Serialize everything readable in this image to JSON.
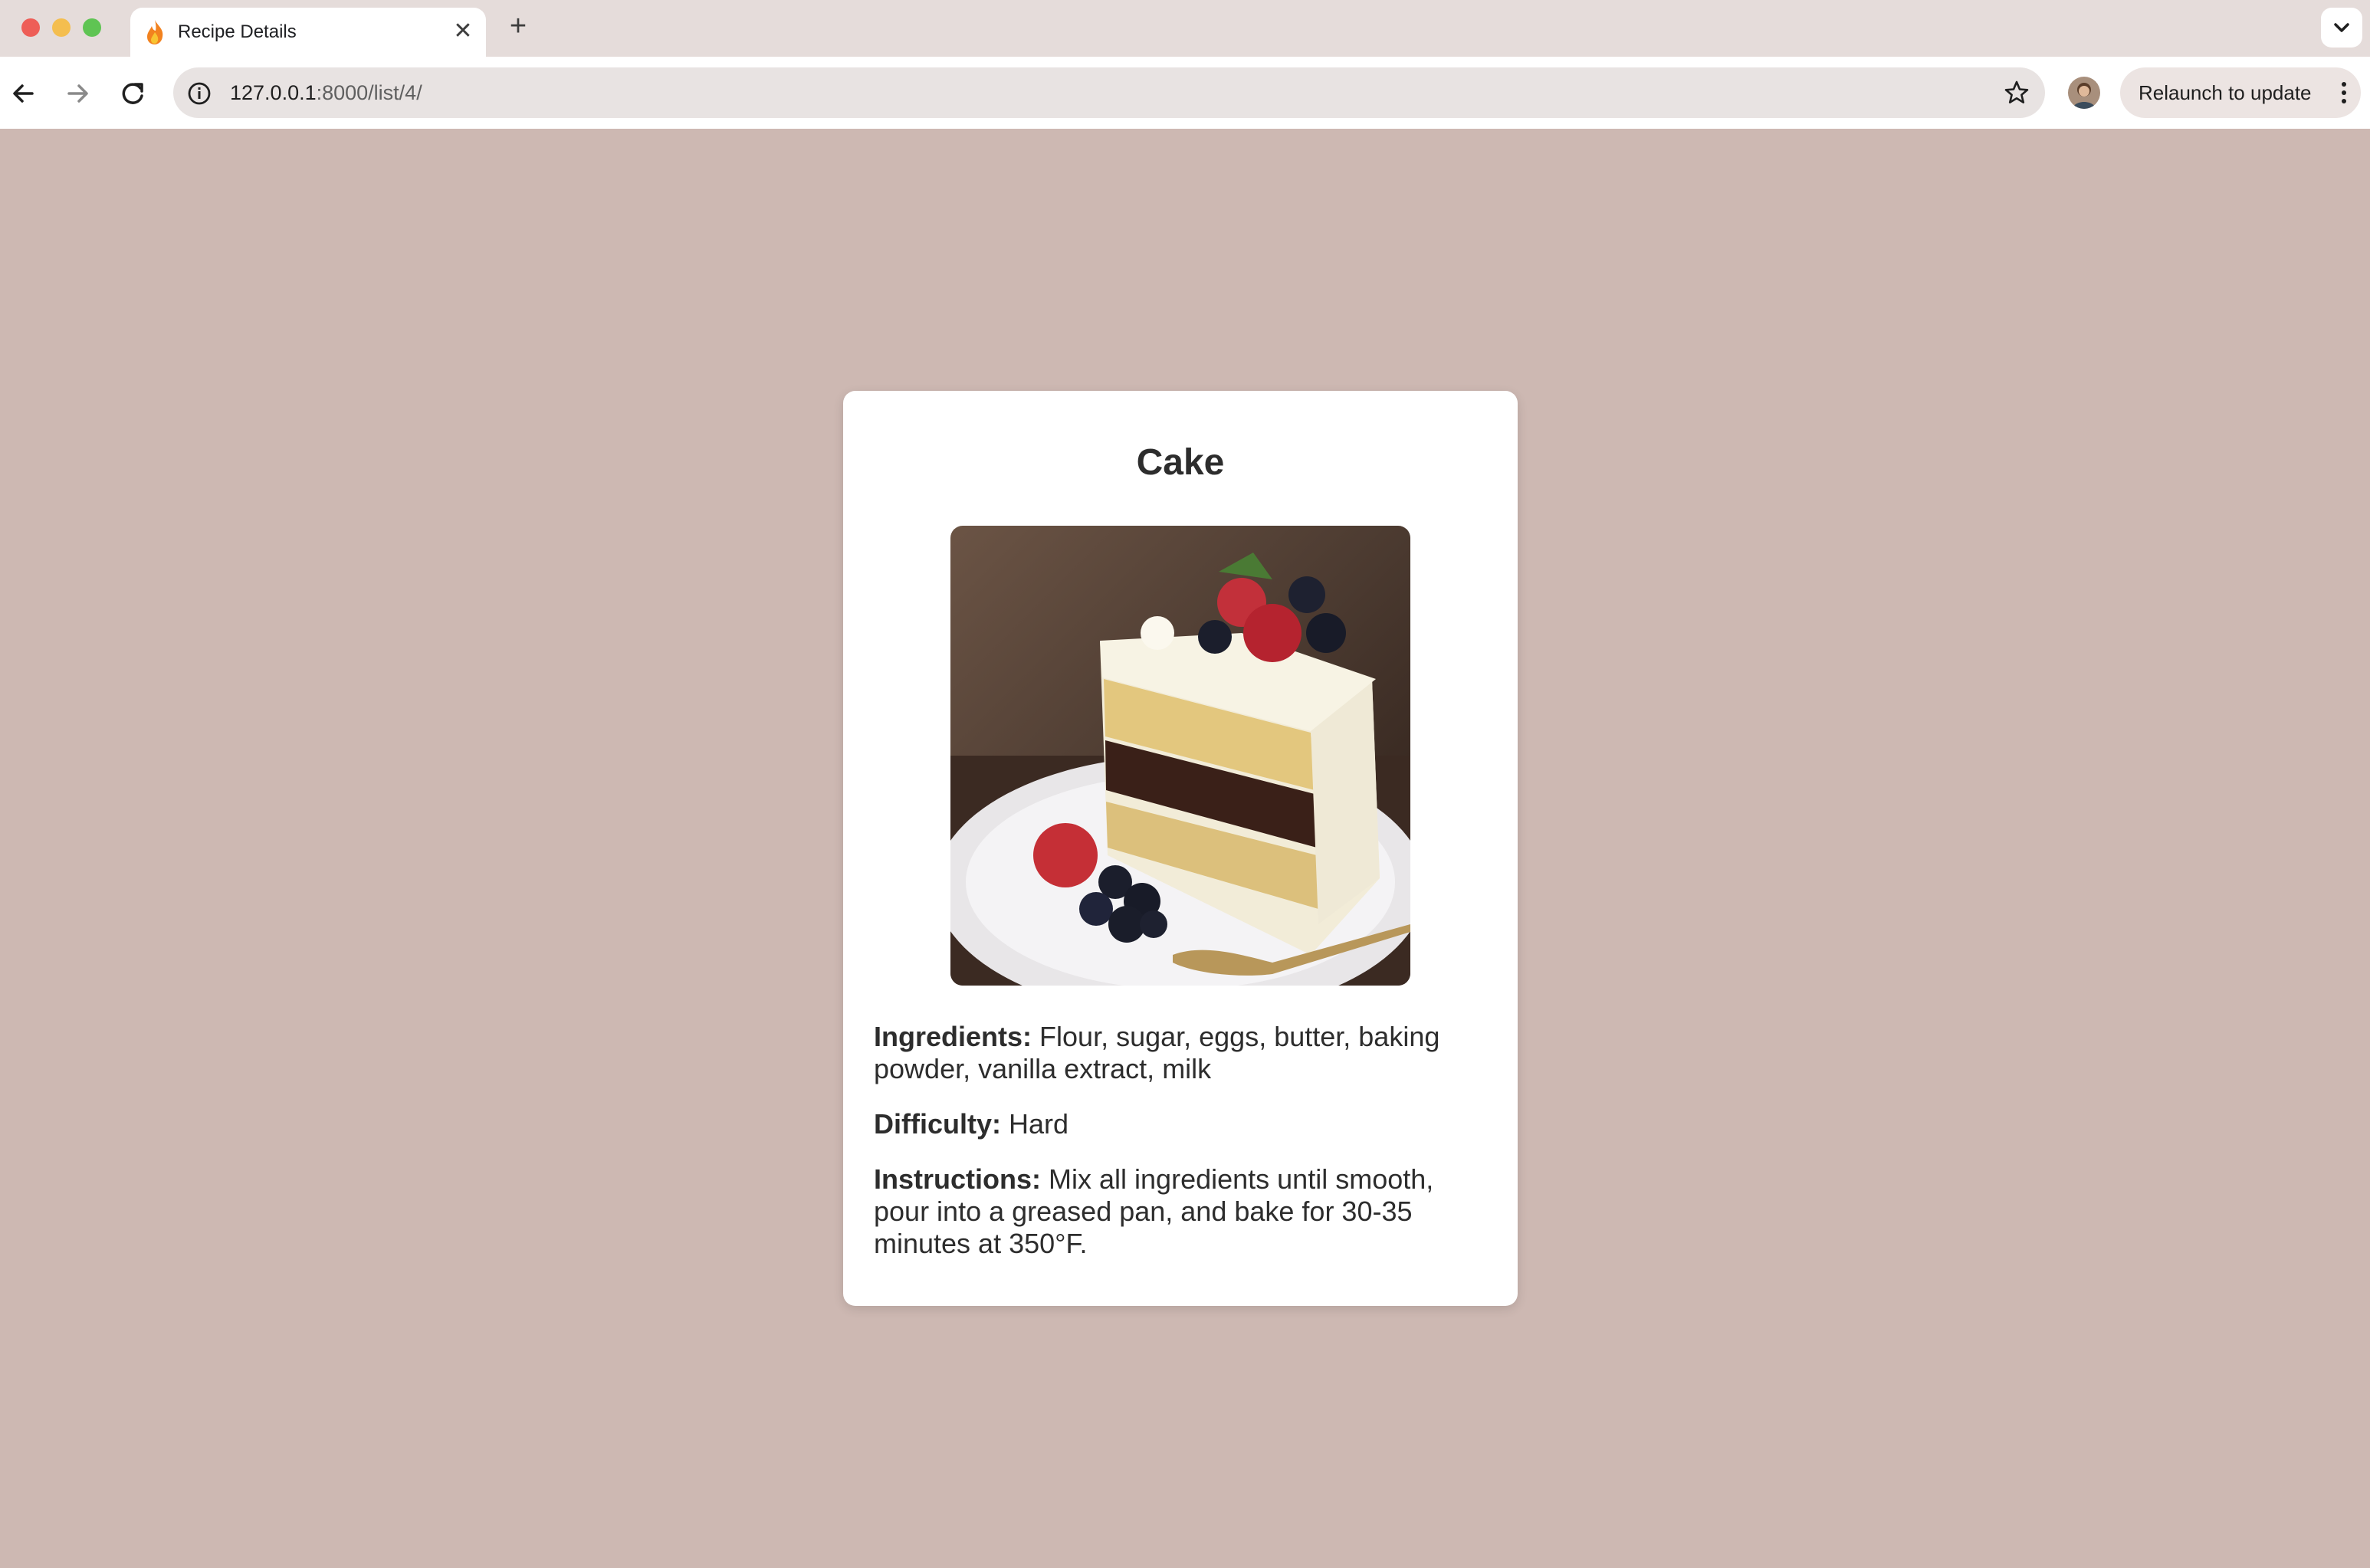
{
  "browser": {
    "tab_title": "Recipe Details",
    "url_host": "127.0.0.1",
    "url_path": ":8000/list/4/",
    "relaunch_label": "Relaunch to update",
    "icons": [
      "flame-favicon-icon",
      "close-icon",
      "plus-icon",
      "chevron-down-icon",
      "back-arrow-icon",
      "forward-arrow-icon",
      "reload-icon",
      "info-icon",
      "star-icon",
      "kebab-menu-icon"
    ]
  },
  "recipe": {
    "title": "Cake",
    "ingredients_label": "Ingredients:",
    "ingredients": "Flour, sugar, eggs, butter, baking powder, vanilla extract, milk",
    "difficulty_label": "Difficulty:",
    "difficulty": "Hard",
    "instructions_label": "Instructions:",
    "instructions": "Mix all ingredients until smooth, pour into a greased pan, and bake for 30-35 minutes at 350°F."
  },
  "colors": {
    "page_background": "#cdb8b2",
    "card_background": "#ffffff",
    "text": "#2d2d2d"
  }
}
